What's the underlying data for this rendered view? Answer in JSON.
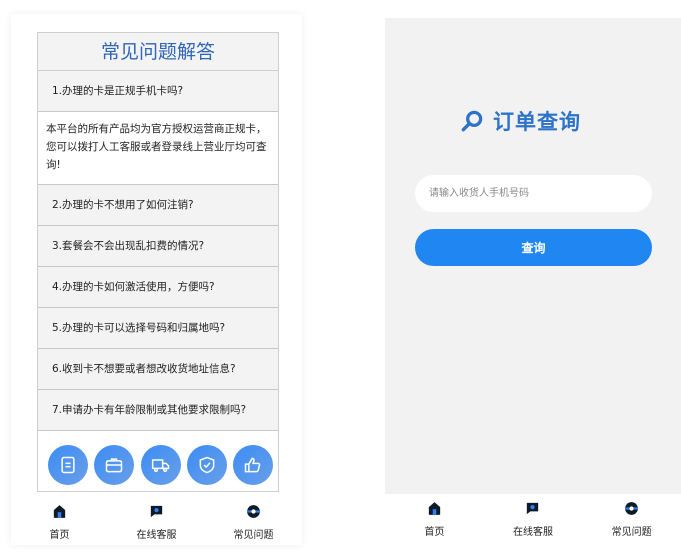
{
  "faq": {
    "title": "常见问题解答",
    "items": [
      {
        "question": "1.办理的卡是正规手机卡吗?"
      },
      {
        "answer": "本平台的所有产品均为官方授权运营商正规卡，您可以拨打人工客服或者登录线上营业厅均可查询!"
      },
      {
        "question": "2.办理的卡不想用了如何注销?"
      },
      {
        "question": "3.套餐会不会出现乱扣费的情况?"
      },
      {
        "question": "4.办理的卡如何激活使用，方便吗?"
      },
      {
        "question": "5.办理的卡可以选择号码和归属地吗?"
      },
      {
        "question": "6.收到卡不想要或者想改收货地址信息?"
      },
      {
        "question": "7.申请办卡有年龄限制或其他要求限制吗?"
      }
    ],
    "feature_icons": [
      {
        "icon": "document-icon"
      },
      {
        "icon": "briefcase-icon"
      },
      {
        "icon": "truck-icon"
      },
      {
        "icon": "shield-check-icon"
      },
      {
        "icon": "thumbs-up-icon"
      }
    ]
  },
  "tabbar": {
    "home": "首页",
    "service": "在线客服",
    "faq": "常见问题"
  },
  "order_query": {
    "title": "订单查询",
    "placeholder": "请输入收货人手机号码",
    "button": "查询"
  },
  "colors": {
    "accent": "#1f86f2",
    "title_blue": "#2f66b8"
  }
}
